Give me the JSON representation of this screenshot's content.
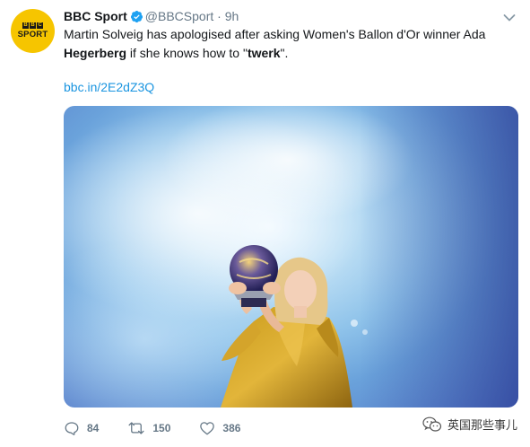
{
  "account": {
    "avatar_top": "BBC",
    "avatar_bottom": "SPORT",
    "display_name": "BBC Sport",
    "handle": "@BBCSport",
    "separator": "·",
    "time": "9h"
  },
  "tweet": {
    "text_part1": "Martin Solveig has apologised after asking Women's Ballon d'Or winner Ada ",
    "text_bold1": "Hegerberg",
    "text_part2": " if she knows how to \"",
    "text_bold2": "twerk",
    "text_part3": "\".",
    "link": "bbc.in/2E2dZ3Q"
  },
  "actions": {
    "replies": "84",
    "retweets": "150",
    "likes": "386"
  },
  "watermark": {
    "text": "英国那些事儿"
  },
  "colors": {
    "link": "#1b95e0",
    "verified": "#1da1f2",
    "muted": "#657786",
    "avatar_bg": "#f6c500"
  }
}
